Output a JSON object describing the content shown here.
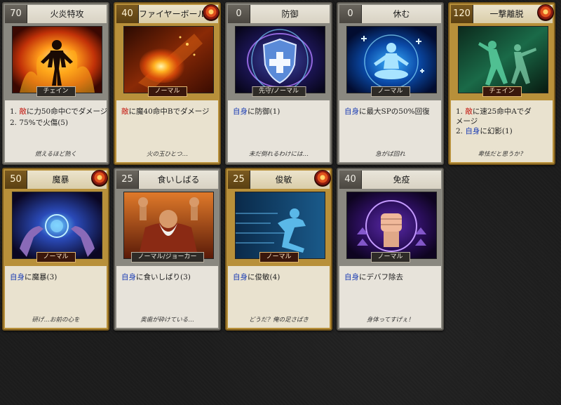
{
  "cards": [
    {
      "cost": "70",
      "title": "火炎特攻",
      "tag": "チェイン",
      "l1": {
        "pre": "1. ",
        "kw": "敵",
        "post": "に力50命中Cでダメージ"
      },
      "l2": {
        "pre": "2. 75%で火傷(5)"
      },
      "flavor": "燃えるほど熱く"
    },
    {
      "cost": "40",
      "title": "ファイヤーボール",
      "tag": "ノーマル",
      "l1": {
        "pre": "",
        "kw": "敵",
        "post": "に魔40命中Bでダメージ"
      },
      "flavor": "火の玉ひとつ…"
    },
    {
      "cost": "0",
      "title": "防御",
      "tag": "先守/ノーマル",
      "l1": {
        "pre": "",
        "kw": "自身",
        "post": "に防御(1)"
      },
      "flavor": "未だ倒れるわけには…"
    },
    {
      "cost": "0",
      "title": "休む",
      "tag": "ノーマル",
      "l1": {
        "pre": "",
        "kw": "自身",
        "post": "に最大SPの50%回復"
      },
      "flavor": "急がば回れ"
    },
    {
      "cost": "120",
      "title": "一撃離脱",
      "tag": "チェイン",
      "l1": {
        "pre": "1. ",
        "kw": "敵",
        "post": "に速25命中Aでダ"
      },
      "l1b": "メージ",
      "l2": {
        "pre": "2. ",
        "kw": "自身",
        "post": "に幻影(1)"
      },
      "flavor": "卑怯だと思うか？"
    },
    {
      "cost": "50",
      "title": "魔暴",
      "tag": "ノーマル",
      "l1": {
        "pre": "",
        "kw": "自身",
        "post": "に魔暴(3)"
      },
      "flavor": "研げ…お前の心を"
    },
    {
      "cost": "25",
      "title": "食いしばる",
      "tag": "ノーマル/ジョーカー",
      "l1": {
        "pre": "",
        "kw": "自身",
        "post": "に食いしばり(3)"
      },
      "flavor": "奥歯が砕けている…"
    },
    {
      "cost": "25",
      "title": "俊敏",
      "tag": "ノーマル",
      "l1": {
        "pre": "",
        "kw": "自身",
        "post": "に俊敏(4)"
      },
      "flavor": "どうだ？俺の足さばき"
    },
    {
      "cost": "40",
      "title": "免疫",
      "tag": "ノーマル",
      "l1": {
        "pre": "",
        "kw": "自身",
        "post": "にデバフ除去"
      },
      "flavor": "身体ってすげぇ！"
    }
  ],
  "icons": {
    "emblem": "fire-emblem-icon"
  },
  "colors": {
    "keyword_enemy": "#c41a12",
    "keyword_self": "#1e3fb4",
    "card_gold": "#b8903a",
    "card_grey": "#8a8880"
  }
}
